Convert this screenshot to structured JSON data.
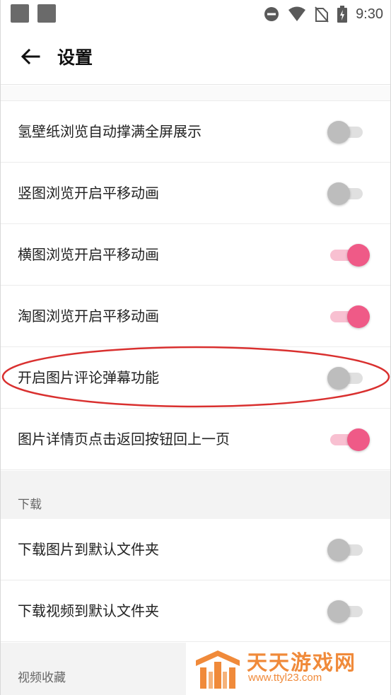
{
  "status_bar": {
    "time": "9:30",
    "icons": [
      "app-square-icon",
      "app-square-icon",
      "do-not-disturb-icon",
      "wifi-icon",
      "no-sim-icon",
      "battery-charging-icon"
    ]
  },
  "app_bar": {
    "back_icon": "arrow-left-icon",
    "title": "设置"
  },
  "settings": {
    "rows": [
      {
        "label": "氢壁纸浏览自动撑满全屏展示",
        "enabled": false
      },
      {
        "label": "竖图浏览开启平移动画",
        "enabled": false
      },
      {
        "label": "横图浏览开启平移动画",
        "enabled": true
      },
      {
        "label": "淘图浏览开启平移动画",
        "enabled": true
      },
      {
        "label": "开启图片评论弹幕功能",
        "enabled": false
      },
      {
        "label": "图片详情页点击返回按钮回上一页",
        "enabled": true
      }
    ],
    "download_section": {
      "header": "下载",
      "rows": [
        {
          "label": "下载图片到默认文件夹",
          "enabled": false
        },
        {
          "label": "下载视频到默认文件夹",
          "enabled": false
        }
      ]
    },
    "video_section": {
      "header": "视频收藏"
    }
  },
  "colors": {
    "accent": "#ef5a87",
    "accent_track": "#f8c0d1",
    "off_thumb": "#bdbdbd",
    "annotation": "#d9302f",
    "watermark": "#f08a3a"
  },
  "watermark": {
    "title": "天天游戏网",
    "url": "www.ttyl23.com"
  }
}
